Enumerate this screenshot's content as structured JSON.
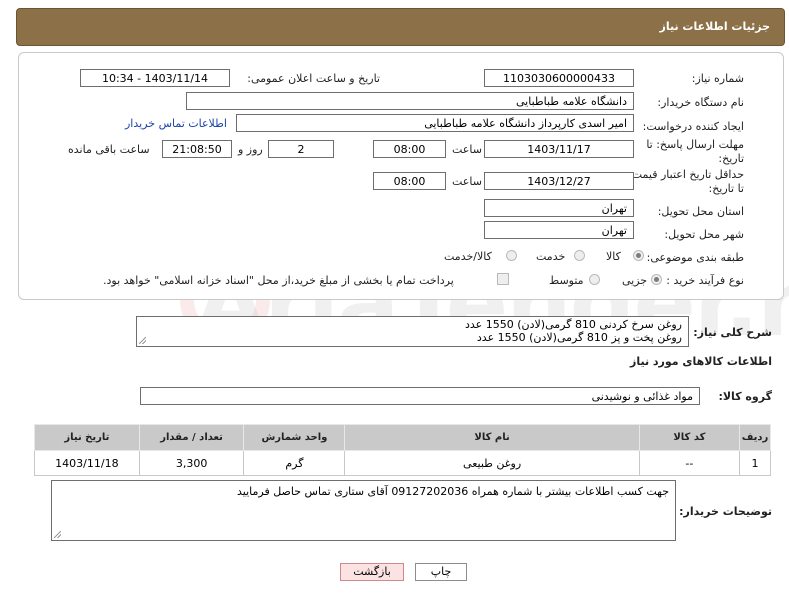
{
  "header": {
    "title": "جزئیات اطلاعات نیاز"
  },
  "form": {
    "need_number_label": "شماره نیاز:",
    "need_number": "1103030600000433",
    "announce_label": "تاریخ و ساعت اعلان عمومی:",
    "announce_value": "1403/11/14 - 10:34",
    "buyer_org_label": "نام دستگاه خریدار:",
    "buyer_org": "دانشگاه علامه طباطبایی",
    "creator_label": "ایجاد کننده درخواست:",
    "creator": "امیر اسدی کارپرداز دانشگاه علامه طباطبایی",
    "contact_link": "اطلاعات تماس خریدار",
    "deadline_label": "مهلت ارسال پاسخ: تا تاریخ:",
    "deadline_date": "1403/11/17",
    "time_label": "ساعت",
    "deadline_time": "08:00",
    "days_value": "2",
    "days_label": "روز و",
    "remaining_time": "21:08:50",
    "remaining_label": "ساعت باقی مانده",
    "validity_label": "حداقل تاریخ اعتبار قیمت: تا تاریخ:",
    "validity_date": "1403/12/27",
    "validity_time": "08:00",
    "province_label": "استان محل تحویل:",
    "province": "تهران",
    "city_label": "شهر محل تحویل:",
    "city": "تهران",
    "category_label": "طبقه بندی موضوعی:",
    "category_options": [
      "کالا",
      "خدمت",
      "کالا/خدمت"
    ],
    "purchase_type_label": "نوع فرآیند خرید :",
    "purchase_options": [
      "جزیی",
      "متوسط"
    ],
    "payment_note": "پرداخت تمام یا بخشی از مبلغ خرید،از محل \"اسناد خزانه اسلامی\" خواهد بود."
  },
  "description": {
    "label": "شرح کلی نیاز:",
    "line1": "روغن سرخ کردنی  810 گرمی(لادن)   1550 عدد",
    "line2": "روغن پخت و پز    810 گرمی(لادن)    1550 عدد"
  },
  "goods": {
    "section_title": "اطلاعات کالاهای مورد نیاز",
    "group_label": "گروه کالا:",
    "group_value": "مواد غذائی و نوشیدنی",
    "columns": [
      "ردیف",
      "کد کالا",
      "نام کالا",
      "واحد شمارش",
      "تعداد / مقدار",
      "تاریخ نیاز"
    ],
    "rows": [
      {
        "index": "1",
        "code": "--",
        "name": "روغن طبیعی",
        "unit": "گرم",
        "qty": "3,300",
        "date": "1403/11/18"
      }
    ]
  },
  "buyer_notes": {
    "label": "توضیحات خریدار:",
    "text": "جهت کسب اطلاعات بیشتر با شماره همراه 09127202036 آقای ستاری تماس حاصل فرمایید"
  },
  "buttons": {
    "print": "چاپ",
    "back": "بازگشت"
  },
  "watermark": "AriaTender.neT",
  "colors": {
    "header": "#8c7048",
    "table_header": "#c9c9c9",
    "link": "#1a44a8",
    "back_button": "#fbe3e3"
  }
}
